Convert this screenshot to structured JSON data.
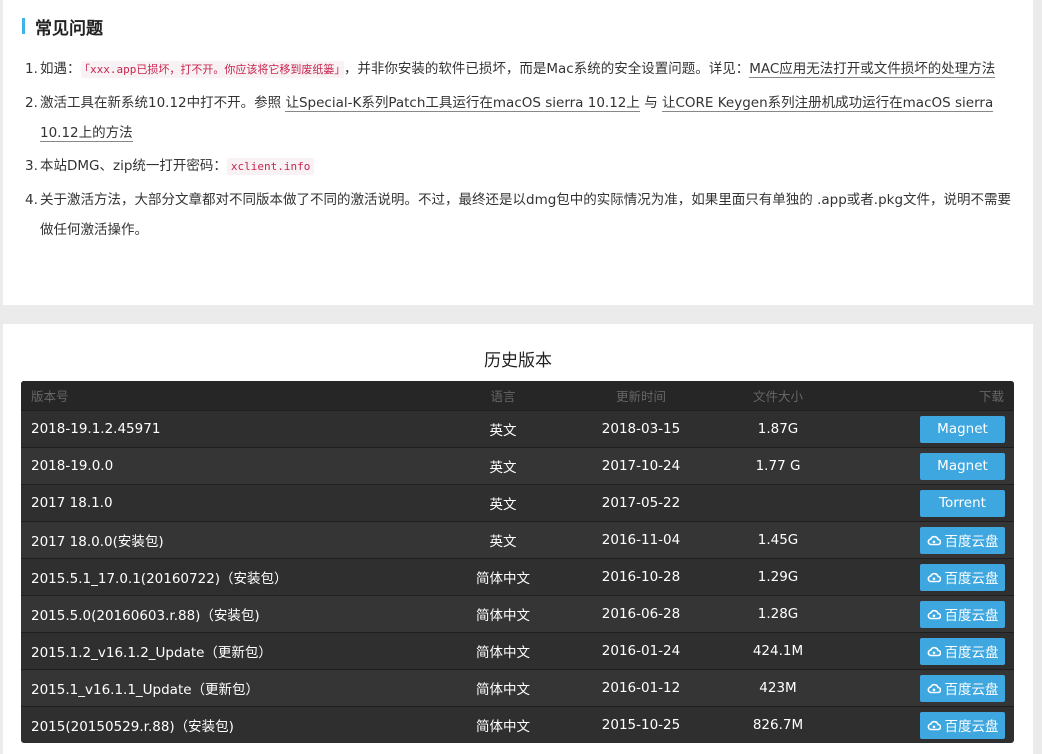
{
  "faq": {
    "title": "常见问题",
    "items": [
      {
        "num": "1.",
        "pre": "如遇：",
        "code": "「xxx.app已损坏，打不开。你应该将它移到废纸篓」",
        "mid": "，并非你安装的软件已损坏，而是Mac系统的安全设置问题。详见：",
        "link": "MAC应用无法打开或文件损坏的处理方法"
      },
      {
        "num": "2.",
        "pre": "激活工具在新系统10.12中打不开。参照",
        "link1": "让Special-K系列Patch工具运行在macOS sierra 10.12上",
        "mid": " 与 ",
        "link2": "让CORE Keygen系列注册机成功运行在macOS sierra 10.12上的方法"
      },
      {
        "num": "3.",
        "pre": "本站DMG、zip统一打开密码：",
        "code": "xclient.info"
      },
      {
        "num": "4.",
        "text": "关于激活方法，大部分文章都对不同版本做了不同的激活说明。不过，最终还是以dmg包中的实际情况为准，如果里面只有单独的 .app或者.pkg文件，说明不需要做任何激活操作。"
      }
    ]
  },
  "history": {
    "title": "历史版本",
    "headers": {
      "version": "版本号",
      "language": "语言",
      "date": "更新时间",
      "size": "文件大小",
      "download": "下载"
    },
    "rows": [
      {
        "version": "2018-19.1.2.45971",
        "language": "英文",
        "date": "2018-03-15",
        "size": "1.87G",
        "download": "Magnet",
        "icon": ""
      },
      {
        "version": "2018-19.0.0",
        "language": "英文",
        "date": "2017-10-24",
        "size": "1.77 G",
        "download": "Magnet",
        "icon": ""
      },
      {
        "version": "2017 18.1.0",
        "language": "英文",
        "date": "2017-05-22",
        "size": "",
        "download": "Torrent",
        "icon": ""
      },
      {
        "version": "2017 18.0.0(安装包)",
        "language": "英文",
        "date": "2016-11-04",
        "size": "1.45G",
        "download": "百度云盘",
        "icon": "cloud-icon"
      },
      {
        "version": "2015.5.1_17.0.1(20160722)（安装包）",
        "language": "简体中文",
        "date": "2016-10-28",
        "size": "1.29G",
        "download": "百度云盘",
        "icon": "cloud-icon"
      },
      {
        "version": "2015.5.0(20160603.r.88)（安装包)",
        "language": "简体中文",
        "date": "2016-06-28",
        "size": "1.28G",
        "download": "百度云盘",
        "icon": "cloud-icon"
      },
      {
        "version": "2015.1.2_v16.1.2_Update（更新包）",
        "language": "简体中文",
        "date": "2016-01-24",
        "size": "424.1M",
        "download": "百度云盘",
        "icon": "cloud-icon"
      },
      {
        "version": "2015.1_v16.1.1_Update（更新包）",
        "language": "简体中文",
        "date": "2016-01-12",
        "size": "423M",
        "download": "百度云盘",
        "icon": "cloud-icon"
      },
      {
        "version": "2015(20150529.r.88)（安装包)",
        "language": "简体中文",
        "date": "2015-10-25",
        "size": "826.7M",
        "download": "百度云盘",
        "icon": "cloud-icon"
      }
    ]
  }
}
